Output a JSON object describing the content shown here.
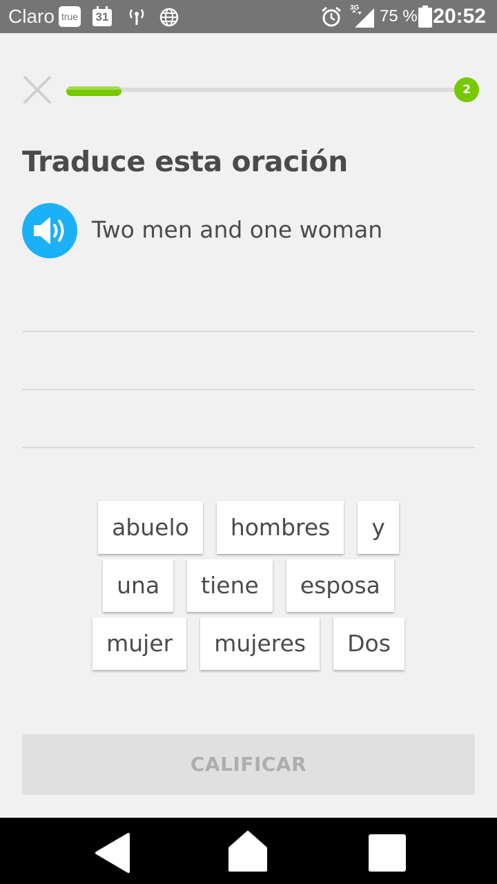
{
  "status_bar": {
    "carrier": "Claro",
    "true_badge": "true",
    "calendar_day": "31",
    "battery_percent": "75 %",
    "network_type": "3G",
    "time": "20:52"
  },
  "lesson": {
    "progress_fraction": 0.14,
    "progress_badge": "2",
    "title": "Traduce esta oración",
    "prompt": "Two men and one woman"
  },
  "word_bank": {
    "rows": [
      [
        "abuelo",
        "hombres",
        "y"
      ],
      [
        "una",
        "tiene",
        "esposa"
      ],
      [
        "mujer",
        "mujeres",
        "Dos"
      ]
    ]
  },
  "check_button_label": "CALIFICAR",
  "colors": {
    "accent_green": "#78c800",
    "speaker_blue": "#1cb0f6",
    "status_bar": "#757575"
  }
}
